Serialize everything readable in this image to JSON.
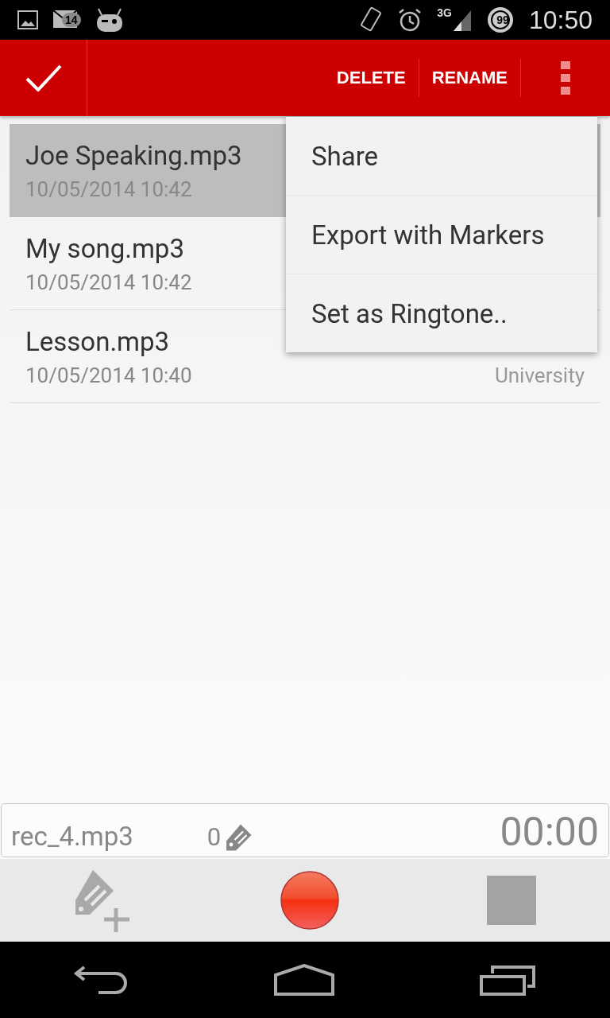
{
  "status_bar": {
    "notification_badge": "14",
    "battery_level": "99",
    "network": "3G",
    "time": "10:50"
  },
  "action_bar": {
    "actions": [
      "DELETE",
      "RENAME"
    ]
  },
  "recordings": [
    {
      "name": "Joe Speaking.mp3",
      "date": "10/05/2014 10:42",
      "selected": true
    },
    {
      "name": "My song.mp3",
      "date": "10/05/2014 10:42",
      "selected": false
    },
    {
      "name": "Lesson.mp3",
      "date": "10/05/2014 10:40",
      "selected": false,
      "category": "University"
    }
  ],
  "menu": {
    "items": [
      "Share",
      "Export with Markers",
      "Set as Ringtone.."
    ]
  },
  "recorder": {
    "filename": "rec_4.mp3",
    "marker_count": "0",
    "elapsed": "00:00"
  }
}
